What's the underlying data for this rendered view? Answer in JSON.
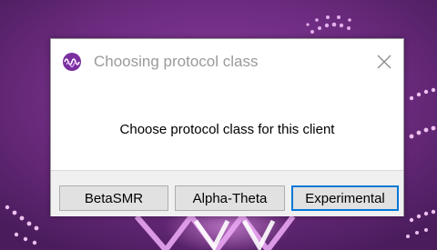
{
  "dialog": {
    "title": "Choosing protocol class",
    "message": "Choose protocol class for this client",
    "buttons": {
      "beta_smr": "BetaSMR",
      "alpha_theta": "Alpha-Theta",
      "experimental": "Experimental"
    },
    "default_button": "Experimental"
  },
  "icons": {
    "app": "brainwave-app-icon",
    "close": "close-icon"
  },
  "colors": {
    "background": "#6d2a78",
    "accent": "#0078d7",
    "title_text": "#9a9a9a"
  }
}
